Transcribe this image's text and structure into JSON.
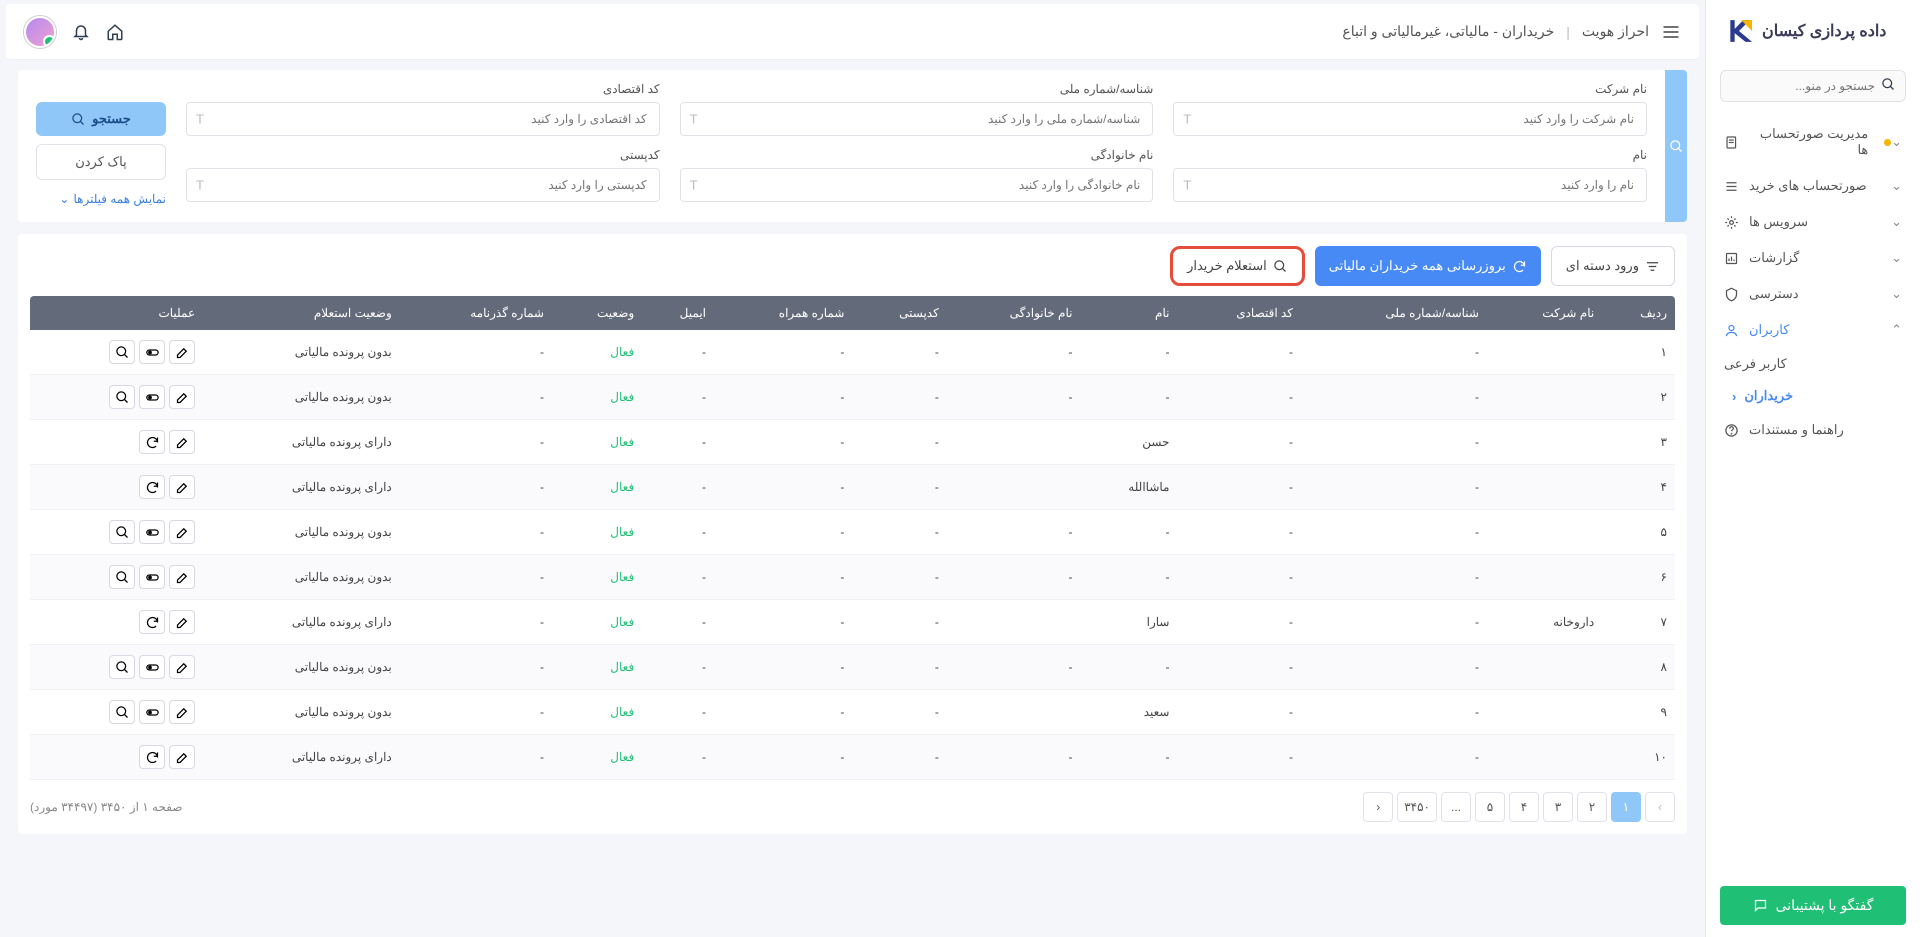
{
  "app": {
    "title": "داده پردازی کیسان"
  },
  "menu_search": {
    "placeholder": "جستجو در منو..."
  },
  "nav": {
    "invoices": "مدیریت صورتحساب ها",
    "purchases": "صورتحساب های خرید",
    "services": "سرویس ها",
    "reports": "گزارشات",
    "access": "دسترسی",
    "users": "کاربران",
    "sub_user": "کاربر فرعی",
    "buyers": "خریداران",
    "help": "راهنما و مستندات"
  },
  "support": "گفتگو با پشتیبانی",
  "breadcrumb": {
    "a": "احراز هویت",
    "b": "خریداران - مالیاتی، غیرمالیاتی و اتباع"
  },
  "filters": {
    "company": {
      "label": "نام شرکت",
      "ph": "نام شرکت را وارد کنید"
    },
    "national": {
      "label": "شناسه/شماره ملی",
      "ph": "شناسه/شماره ملی را وارد کنید"
    },
    "economic": {
      "label": "کد اقتصادی",
      "ph": "کد اقتصادی را وارد کنید"
    },
    "name": {
      "label": "نام",
      "ph": "نام را وارد کنید"
    },
    "lname": {
      "label": "نام خانوادگی",
      "ph": "نام خانوادگی را وارد کنید"
    },
    "postal": {
      "label": "کدپستی",
      "ph": "کدپستی را وارد کنید"
    },
    "search_btn": "جستجو",
    "clear_btn": "پاک کردن",
    "show_all": "نمایش همه فیلترها"
  },
  "table": {
    "actions": {
      "batch": "ورود دسته ای",
      "update": "بروزرسانی همه خریداران مالیاتی",
      "inquiry": "استعلام خریدار"
    },
    "headers": [
      "ردیف",
      "نام شرکت",
      "شناسه/شماره ملی",
      "کد اقتصادی",
      "نام",
      "نام خانوادگی",
      "کدپستی",
      "شماره همراه",
      "ایمیل",
      "وضعیت",
      "شماره گذرنامه",
      "وضعیت استعلام",
      "عملیات"
    ],
    "rows": [
      {
        "idx": "۱",
        "company": "",
        "nat": "-",
        "eco": "-",
        "name": "-",
        "lname": "-",
        "postal": "-",
        "mobile": "-",
        "email": "-",
        "status": "فعال",
        "passport": "-",
        "inq": "بدون پرونده مالیاتی",
        "ops": 3
      },
      {
        "idx": "۲",
        "company": "",
        "nat": "-",
        "eco": "-",
        "name": "-",
        "lname": "-",
        "postal": "-",
        "mobile": "-",
        "email": "-",
        "status": "فعال",
        "passport": "-",
        "inq": "بدون پرونده مالیاتی",
        "ops": 3
      },
      {
        "idx": "۳",
        "company": "",
        "nat": "-",
        "eco": "-",
        "name": "حسن",
        "lname": "",
        "postal": "-",
        "mobile": "-",
        "email": "-",
        "status": "فعال",
        "passport": "-",
        "inq": "دارای پرونده مالیاتی",
        "ops": 2
      },
      {
        "idx": "۴",
        "company": "",
        "nat": "-",
        "eco": "-",
        "name": "ماشاالله",
        "lname": "",
        "postal": "-",
        "mobile": "-",
        "email": "-",
        "status": "فعال",
        "passport": "-",
        "inq": "دارای پرونده مالیاتی",
        "ops": 2
      },
      {
        "idx": "۵",
        "company": "",
        "nat": "-",
        "eco": "-",
        "name": "-",
        "lname": "-",
        "postal": "-",
        "mobile": "-",
        "email": "-",
        "status": "فعال",
        "passport": "-",
        "inq": "بدون پرونده مالیاتی",
        "ops": 3
      },
      {
        "idx": "۶",
        "company": "",
        "nat": "-",
        "eco": "-",
        "name": "-",
        "lname": "-",
        "postal": "-",
        "mobile": "-",
        "email": "-",
        "status": "فعال",
        "passport": "-",
        "inq": "بدون پرونده مالیاتی",
        "ops": 3
      },
      {
        "idx": "۷",
        "company": "داروخانه",
        "nat": "-",
        "eco": "-",
        "name": "سارا",
        "lname": "",
        "postal": "-",
        "mobile": "-",
        "email": "-",
        "status": "فعال",
        "passport": "-",
        "inq": "دارای پرونده مالیاتی",
        "ops": 2
      },
      {
        "idx": "۸",
        "company": "",
        "nat": "-",
        "eco": "-",
        "name": "-",
        "lname": "-",
        "postal": "-",
        "mobile": "-",
        "email": "-",
        "status": "فعال",
        "passport": "-",
        "inq": "بدون پرونده مالیاتی",
        "ops": 3
      },
      {
        "idx": "۹",
        "company": "",
        "nat": "-",
        "eco": "-",
        "name": "سعید",
        "lname": "",
        "postal": "-",
        "mobile": "-",
        "email": "-",
        "status": "فعال",
        "passport": "-",
        "inq": "بدون پرونده مالیاتی",
        "ops": 3
      },
      {
        "idx": "۱۰",
        "company": "",
        "nat": "-",
        "eco": "-",
        "name": "-",
        "lname": "-",
        "postal": "-",
        "mobile": "-",
        "email": "-",
        "status": "فعال",
        "passport": "-",
        "inq": "دارای پرونده مالیاتی",
        "ops": 2
      }
    ]
  },
  "pagination": {
    "pages": [
      "۱",
      "۲",
      "۳",
      "۴",
      "۵",
      "...",
      "۳۴۵۰"
    ],
    "info": "صفحه ۱ از ۳۴۵۰ (۳۴۴۹۷ مورد)"
  }
}
